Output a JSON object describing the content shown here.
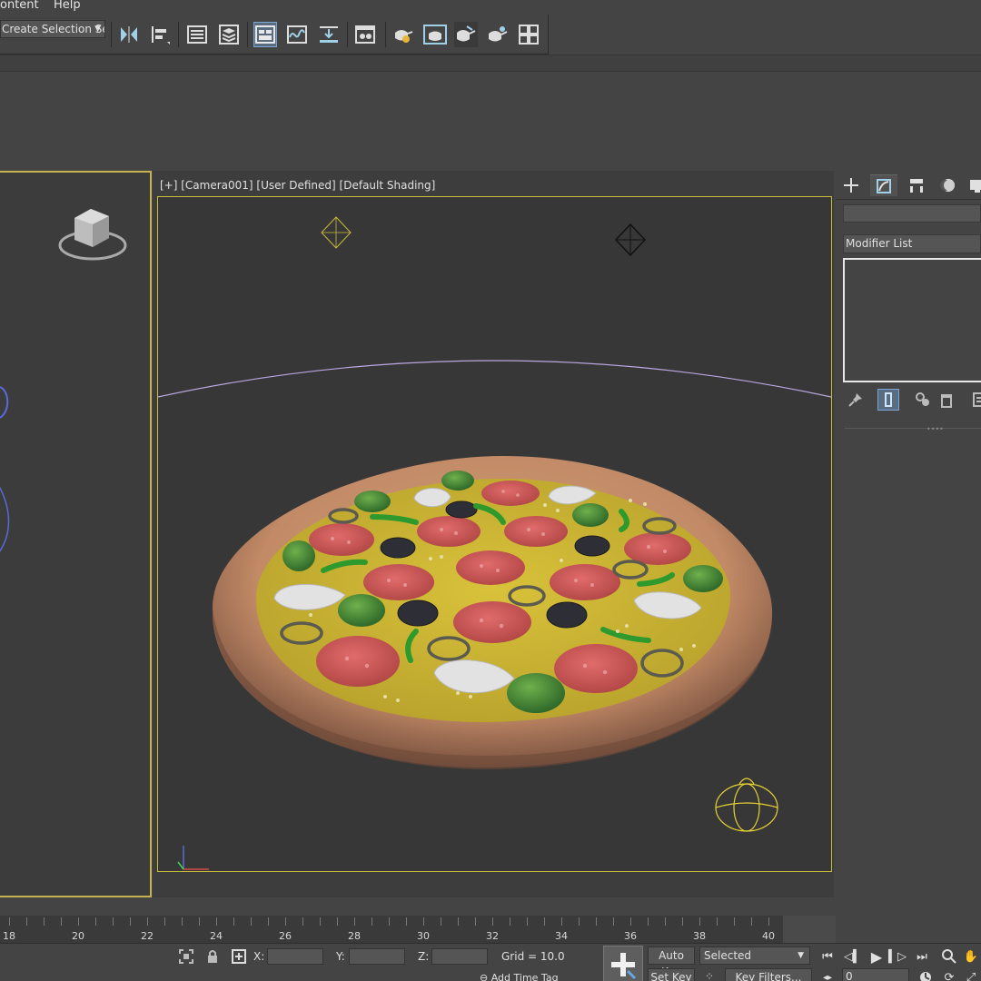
{
  "menu": {
    "items": [
      "ontent",
      "Help"
    ]
  },
  "toolbar": {
    "selection_set_value": "Create Selection Se",
    "buttons": [
      "mirror-icon",
      "align-icon",
      "scene-explorer-icon",
      "layer-explorer-icon",
      "ribbon-toggle-icon",
      "curve-editor-icon",
      "dope-sheet-icon",
      "material-editor-icon",
      "render-setup-icon",
      "rendered-frame-window-icon",
      "render-production-icon",
      "render-iterative-icon",
      "render-online-icon",
      "more-tools-icon"
    ]
  },
  "viewport": {
    "label": "[+] [Camera001] [User Defined] [Default Shading]"
  },
  "command_panel": {
    "tabs": [
      "create-tab",
      "modify-tab",
      "hierarchy-tab",
      "motion-tab",
      "display-tab"
    ],
    "active_tab": "modify-tab",
    "modifier_list_label": "Modifier List"
  },
  "timeline": {
    "ticks": [
      "18",
      "20",
      "22",
      "24",
      "26",
      "28",
      "30",
      "32",
      "34",
      "36",
      "38",
      "40"
    ]
  },
  "status": {
    "x_label": "X:",
    "y_label": "Y:",
    "z_label": "Z:",
    "grid": "Grid = 10.0",
    "add_time_tag": "Add Time Tag",
    "auto_key": "Auto Key",
    "set_key": "Set Key",
    "selected_option": "Selected",
    "key_filters": "Key Filters...",
    "frame_value": "0"
  },
  "colors": {
    "selection_border": "#c9bd3a",
    "active_button": "#5a6d80",
    "background": "#444444"
  }
}
